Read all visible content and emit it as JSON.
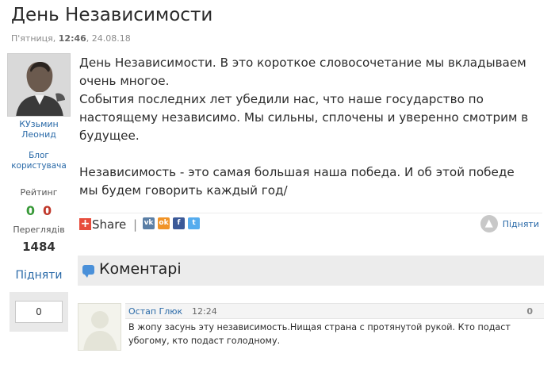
{
  "post": {
    "title": "День Независимости",
    "meta_day": "П'ятниця,",
    "meta_time": "12:46",
    "meta_date": ", 24.08.18",
    "paragraphs": [
      "День Независимости. В это короткое словосочетание мы вкладываем очень многое.",
      "События последних лет убедили нас, что наше государство по настоящему независимо. Мы сильны, сплочены и уверенно смотрим в будущее.",
      "Независимость - это самая большая наша победа. И об этой победе мы будем говорить каждый год/"
    ]
  },
  "author": {
    "name_line1": "КУзьмин",
    "name_line2": "Леонид",
    "blog_line1": "Блог",
    "blog_line2": "користувача",
    "rating_label": "Рейтинг",
    "rating_plus": "0",
    "rating_minus": "0",
    "views_label": "Переглядів",
    "views_value": "1484",
    "up_label": "Підняти",
    "bottom_value": "0"
  },
  "share": {
    "share_label": "Share",
    "separator": "|",
    "icons": [
      "vk-icon",
      "odnoklassniki-icon",
      "facebook-icon",
      "twitter-icon"
    ],
    "raise_label": "Підняти"
  },
  "comments": {
    "header": "Коментарі",
    "items": [
      {
        "author": "Остап Глюк",
        "time": "12:24",
        "score": "0",
        "text": "В жопу засунь эту независимость.Нищая страна с протянутой рукой. Кто подаст убогому, кто подаст голодному."
      }
    ]
  },
  "colors": {
    "link": "#2a6aa8",
    "positive": "#3a9a3a",
    "negative": "#c0392b"
  }
}
